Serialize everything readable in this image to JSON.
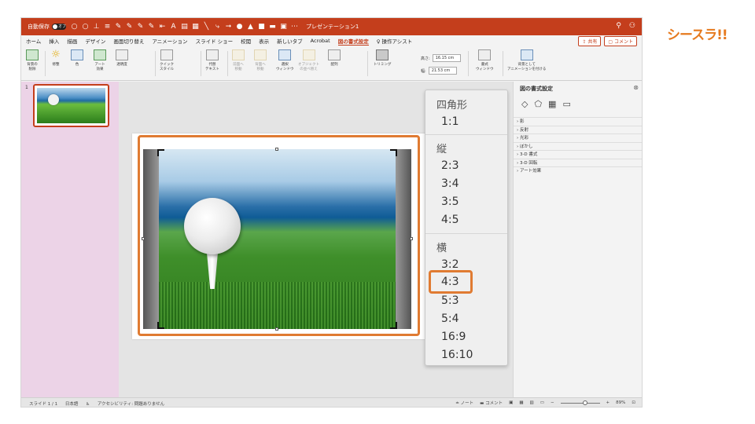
{
  "brand": "シースラ!!",
  "titlebar": {
    "autosave_label": "自動保存",
    "autosave_state": "オフ",
    "doc_title": "プレゼンテーション1",
    "search_icon": "search-icon",
    "share_icon": "share-icon"
  },
  "menu": {
    "tabs": [
      "ホーム",
      "挿入",
      "描画",
      "デザイン",
      "画面切り替え",
      "アニメーション",
      "スライド ショー",
      "校閲",
      "表示",
      "新しいタブ",
      "Acrobat",
      "図の書式設定"
    ],
    "active_tab": "図の書式設定",
    "assist": "操作アシスト",
    "share_button": "共有",
    "comment_button": "コメント"
  },
  "ribbon": {
    "remove_bg": "背景の\n削除",
    "corrections": "修整",
    "color": "色",
    "artistic": "アート\n効果",
    "transparency": "透明度",
    "quick_styles": "クイック\nスタイル",
    "alt_text": "代替\nテキスト",
    "bring_forward": "前面へ\n移動",
    "send_backward": "背面へ\n移動",
    "selection_pane": "選択\nウィンドウ",
    "object_pane": "オブジェクト\nの並べ替え",
    "align": "配列",
    "crop": "トリミング",
    "height_label": "高さ:",
    "height_value": "16.15 cm",
    "width_label": "幅:",
    "width_value": "21.53 cm",
    "format_pane": "書式\nウィンドウ",
    "animate_bg": "背景として\nアニメーションを付ける"
  },
  "thumbnails": {
    "slide_number": "1"
  },
  "crop_menu": {
    "square_heading": "四角形",
    "square_items": [
      "1:1"
    ],
    "portrait_heading": "縦",
    "portrait_items": [
      "2:3",
      "3:4",
      "3:5",
      "4:5"
    ],
    "landscape_heading": "横",
    "landscape_items": [
      "3:2",
      "4:3",
      "5:3",
      "5:4",
      "16:9",
      "16:10"
    ],
    "selected": "4:3"
  },
  "format_pane": {
    "title": "図の書式設定",
    "sections": [
      "影",
      "反射",
      "光彩",
      "ぼかし",
      "3-D 書式",
      "3-D 回転",
      "アート効果"
    ]
  },
  "statusbar": {
    "slide_info": "スライド 1 / 1",
    "language": "日本語",
    "accessibility": "アクセシビリティ: 問題ありません",
    "notes": "ノート",
    "comments": "コメント",
    "zoom": "89%"
  },
  "colors": {
    "accent": "#c43e1c",
    "highlight": "#e07b32",
    "brand": "#e67a1f"
  }
}
